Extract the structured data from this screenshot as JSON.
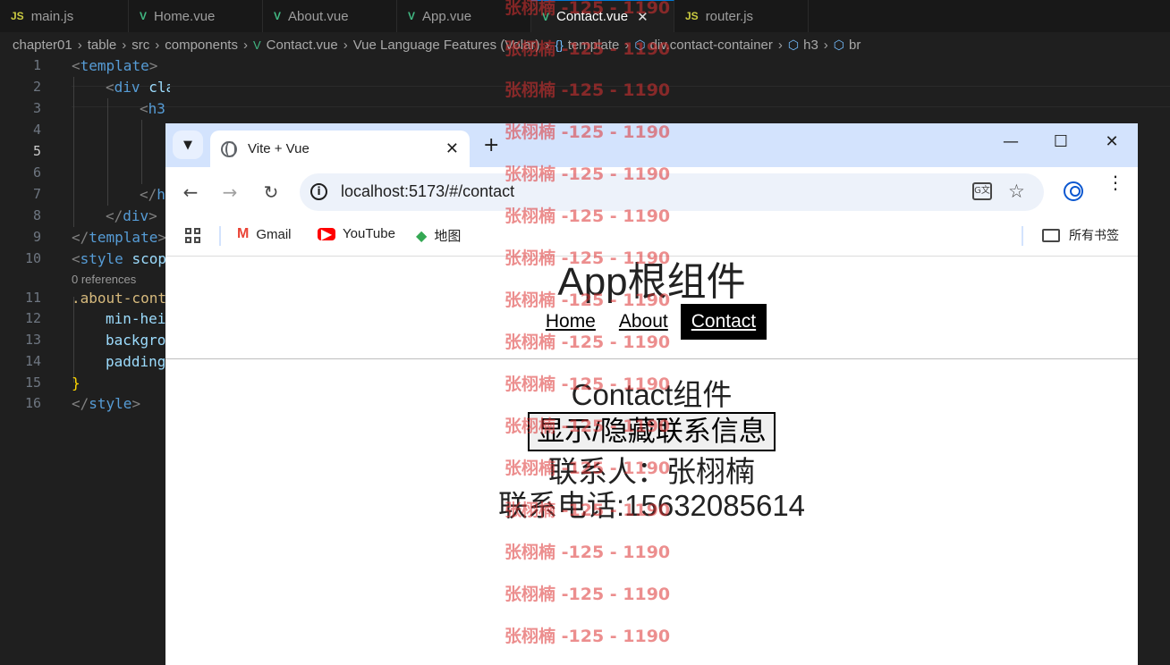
{
  "editor": {
    "tabs": [
      {
        "icon": "JS",
        "label": "main.js",
        "active": false
      },
      {
        "icon": "V",
        "label": "Home.vue",
        "active": false
      },
      {
        "icon": "V",
        "label": "About.vue",
        "active": false
      },
      {
        "icon": "V",
        "label": "App.vue",
        "active": false
      },
      {
        "icon": "V",
        "label": "Contact.vue",
        "active": true
      },
      {
        "icon": "JS",
        "label": "router.js",
        "active": false
      }
    ],
    "breadcrumb": [
      "chapter01",
      "table",
      "src",
      "components",
      "Contact.vue",
      "Vue Language Features (Volar)",
      "template",
      "div.contact-container",
      "h3",
      "br"
    ],
    "line_numbers": [
      "1",
      "2",
      "3",
      "4",
      "5",
      "6",
      "7",
      "8",
      "9",
      "10",
      "11",
      "12",
      "13",
      "14",
      "15",
      "16"
    ],
    "references_label": "0 references"
  },
  "browser": {
    "tab_title": "Vite + Vue",
    "url": "localhost:5173/#/contact",
    "bookmarks": [
      {
        "icon": "gmail-icon",
        "label": "Gmail"
      },
      {
        "icon": "youtube-icon",
        "label": "YouTube"
      },
      {
        "icon": "maps-icon",
        "label": "地图"
      }
    ],
    "all_bookmarks_label": "所有书签"
  },
  "page": {
    "app_title": "App根组件",
    "nav": [
      {
        "label": "Home",
        "active": false
      },
      {
        "label": "About",
        "active": false
      },
      {
        "label": "Contact",
        "active": true
      }
    ],
    "contact_title": "Contact组件",
    "toggle_label": "显示/隐藏联系信息",
    "contact_person": "联系人：张栩楠",
    "contact_phone": "联系电话:15632085614"
  },
  "watermark": {
    "text": "张栩楠 -125 - 1190"
  }
}
